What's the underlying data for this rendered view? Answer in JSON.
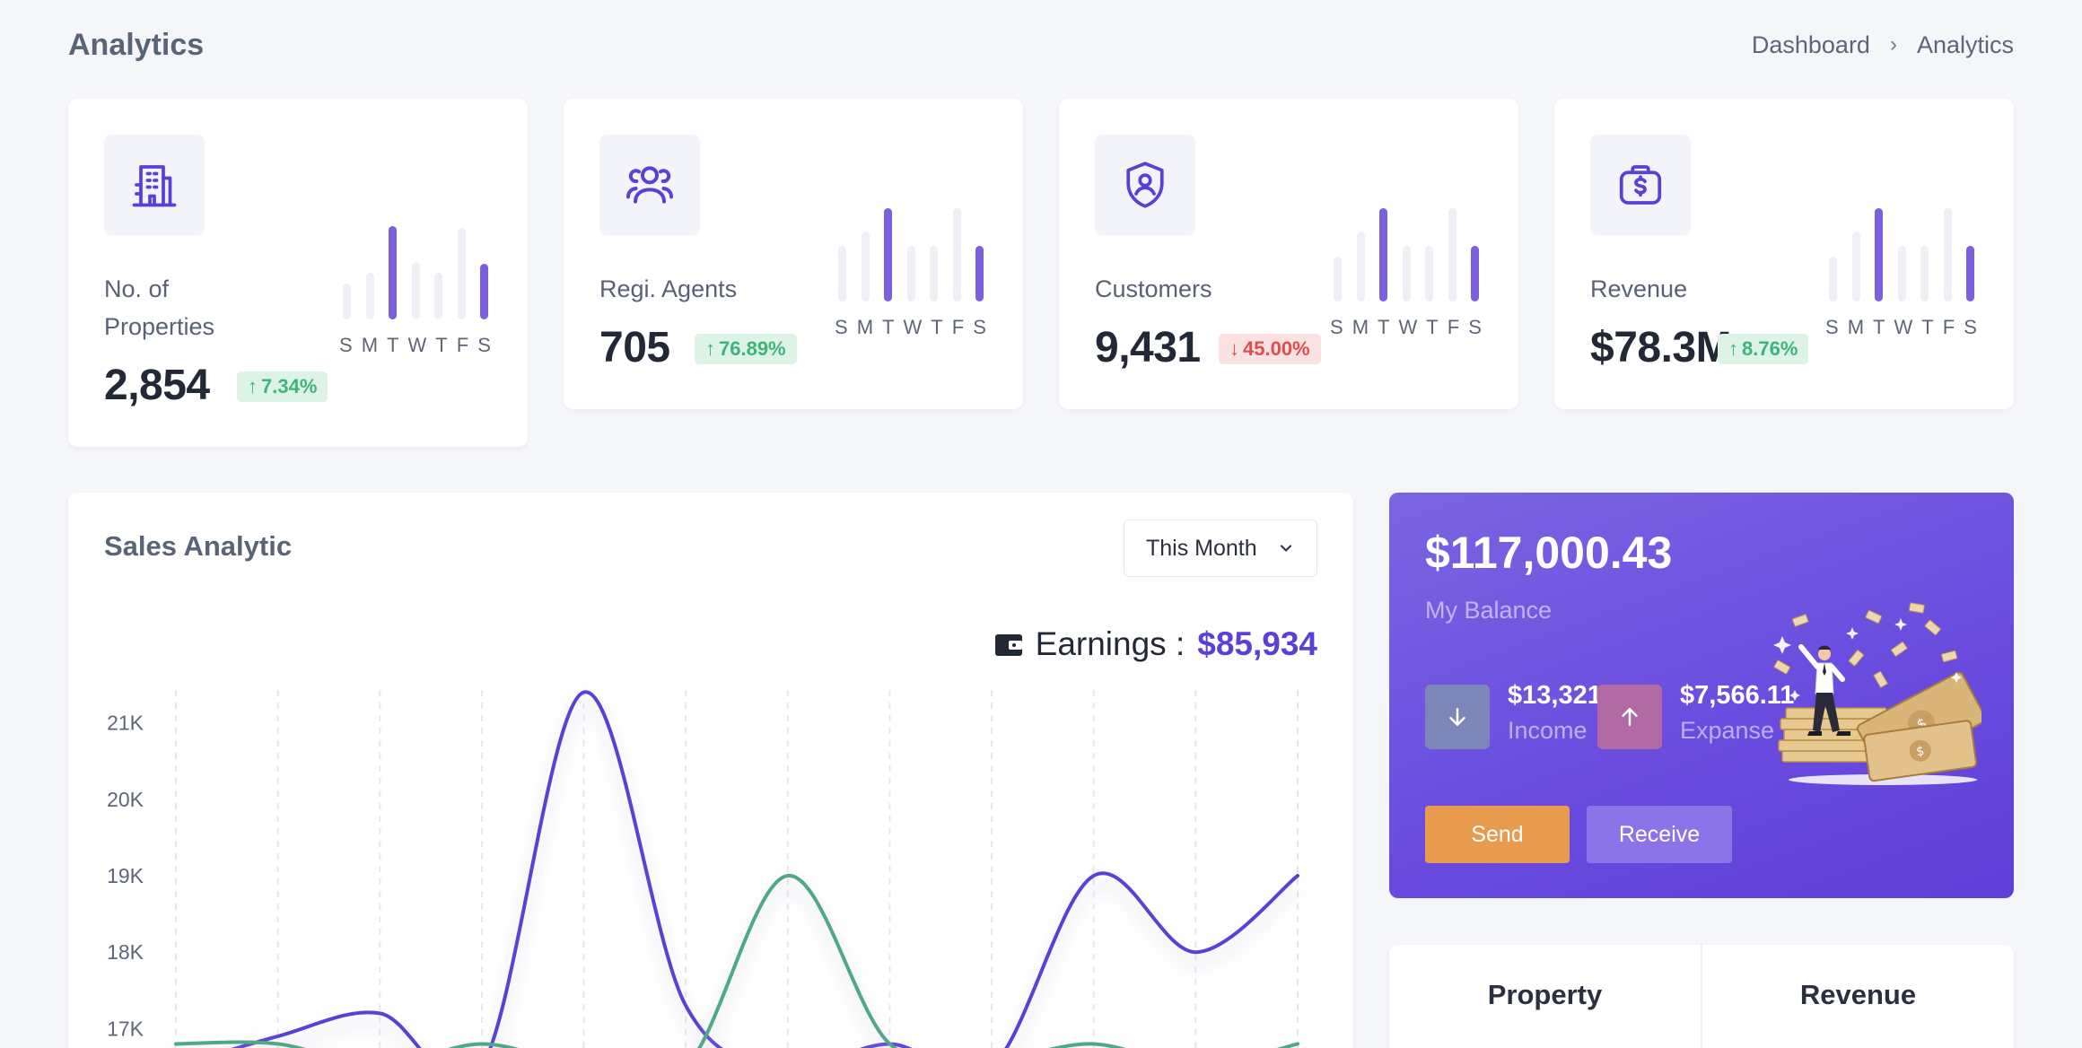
{
  "header": {
    "title": "Analytics",
    "breadcrumb": [
      "Dashboard",
      "Analytics"
    ],
    "breadcrumb_separator": "›"
  },
  "stats": [
    {
      "label": "No. of Properties",
      "value": "2,854",
      "change": "7.34%",
      "trend": "up",
      "icon": "building-icon",
      "days": [
        "S",
        "M",
        "T",
        "W",
        "T",
        "F",
        "S"
      ],
      "bars": [
        0.38,
        0.5,
        1.0,
        0.62,
        0.5,
        0.98,
        0.6
      ],
      "highlight": [
        2,
        6
      ]
    },
    {
      "label": "Regi. Agents",
      "value": "705",
      "change": "76.89%",
      "trend": "up",
      "icon": "users-icon",
      "days": [
        "S",
        "M",
        "T",
        "W",
        "T",
        "F",
        "S"
      ],
      "bars": [
        0.6,
        0.75,
        1.0,
        0.6,
        0.6,
        1.0,
        0.6
      ],
      "highlight": [
        2,
        6
      ]
    },
    {
      "label": "Customers",
      "value": "9,431",
      "change": "45.00%",
      "trend": "down",
      "icon": "user-shield-icon",
      "days": [
        "S",
        "M",
        "T",
        "W",
        "T",
        "F",
        "S"
      ],
      "bars": [
        0.48,
        0.75,
        1.0,
        0.6,
        0.6,
        1.0,
        0.6
      ],
      "highlight": [
        2,
        6
      ]
    },
    {
      "label": "Revenue",
      "value": "$78.3M",
      "change": "8.76%",
      "trend": "up",
      "icon": "money-bag-icon",
      "days": [
        "S",
        "M",
        "T",
        "W",
        "T",
        "F",
        "S"
      ],
      "bars": [
        0.48,
        0.75,
        1.0,
        0.6,
        0.6,
        1.0,
        0.6
      ],
      "highlight": [
        2,
        6
      ]
    }
  ],
  "sales": {
    "title": "Sales Analytic",
    "period": "This Month",
    "earnings_label": "Earnings :",
    "earnings_value": "$85,934"
  },
  "chart_data": {
    "type": "line",
    "title": "",
    "ylabel": "",
    "ylim": [
      16.5,
      21.5
    ],
    "y_ticks": [
      "21K",
      "20K",
      "19K",
      "18K",
      "17K"
    ],
    "y_tick_values": [
      21,
      20,
      19,
      18,
      17
    ],
    "x": [
      0,
      1,
      2,
      3,
      4,
      5,
      6,
      7,
      8,
      9,
      10,
      11
    ],
    "series": [
      {
        "color": "#5b3fd6",
        "values": [
          16.5,
          16.9,
          17.2,
          16.5,
          21.4,
          17.3,
          16.5,
          16.8,
          16.5,
          19.0,
          18.0,
          19.0
        ]
      },
      {
        "color": "#4fa886",
        "values": [
          16.8,
          16.8,
          16.5,
          16.8,
          16.5,
          16.5,
          19.0,
          16.8,
          16.6,
          16.8,
          16.5,
          16.8
        ]
      }
    ]
  },
  "balance": {
    "amount": "$117,000.43",
    "label": "My Balance",
    "income_amount": "$13,321.12",
    "income_label": "Income",
    "expense_amount": "$7,566.11",
    "expense_label": "Expanse",
    "send_label": "Send",
    "receive_label": "Receive"
  },
  "tabs": [
    "Property",
    "Revenue"
  ],
  "colors": {
    "accent": "#5b3fd6",
    "up": "#3fb47a",
    "down": "#e14d4d",
    "send": "#e89b4e"
  }
}
